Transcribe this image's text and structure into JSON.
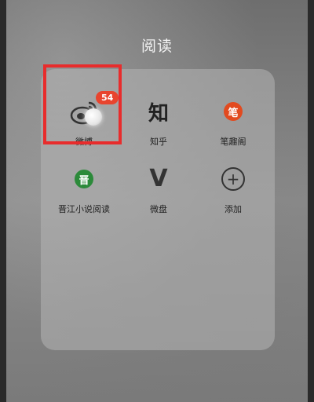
{
  "folder": {
    "title": "阅读"
  },
  "apps": [
    {
      "label": "微博",
      "badge": "54",
      "icon": "weibo-icon"
    },
    {
      "label": "知乎",
      "glyph": "知",
      "icon": "zhihu-icon"
    },
    {
      "label": "笔趣阁",
      "glyph": "笔",
      "icon": "biquge-icon"
    },
    {
      "label": "晋江小说阅读",
      "glyph": "晋",
      "icon": "jinjiang-icon"
    },
    {
      "label": "微盘",
      "glyph": "V",
      "icon": "weipan-icon"
    },
    {
      "label": "添加",
      "glyph": "+",
      "icon": "add-icon"
    }
  ],
  "colors": {
    "badge": "#e8442e",
    "highlight": "#e82c2c"
  }
}
